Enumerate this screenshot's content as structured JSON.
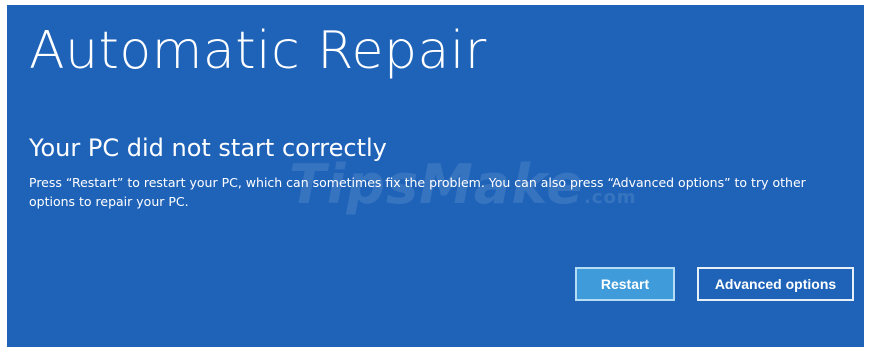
{
  "screen": {
    "title": "Automatic Repair",
    "subtitle": "Your PC did not start correctly",
    "message": "Press “Restart” to restart your PC, which can sometimes fix the problem. You can also press “Advanced options” to try other options to repair your PC.",
    "watermark": {
      "main": "TipsMake",
      "suffix": ".com"
    }
  },
  "buttons": {
    "restart_label": "Restart",
    "advanced_label": "Advanced options"
  },
  "colors": {
    "background": "#1f63b9",
    "primary_button": "#3f9bd9",
    "text": "#ffffff"
  }
}
